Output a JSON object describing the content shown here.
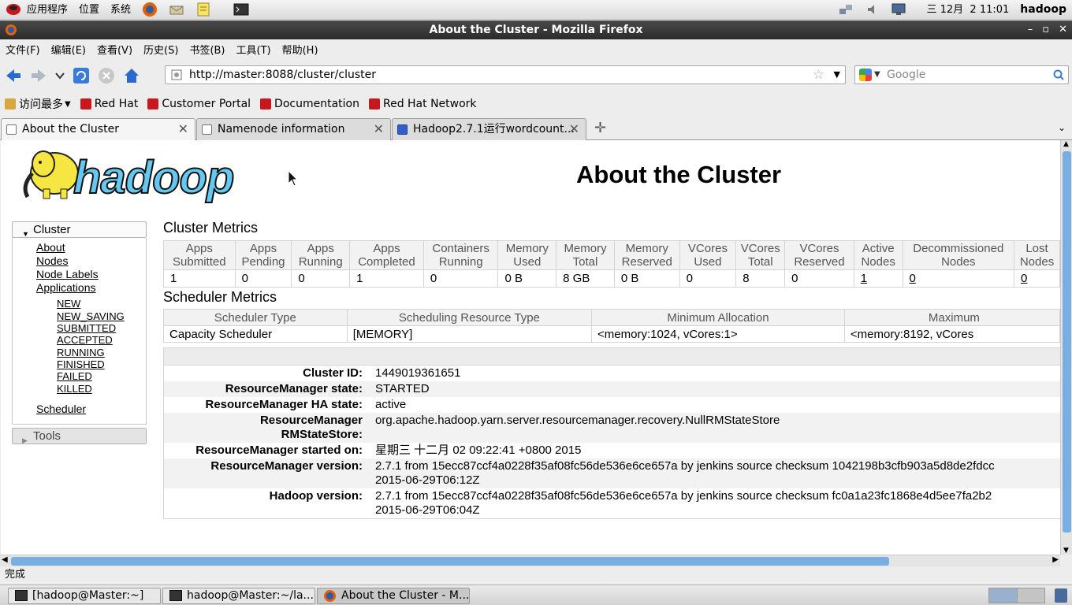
{
  "system_panel": {
    "menus": [
      "应用程序",
      "位置",
      "系统"
    ],
    "clock": "三 12月  2 11:01",
    "user": "hadoop"
  },
  "window": {
    "title": "About the Cluster - Mozilla Firefox"
  },
  "menubar": {
    "items": [
      "文件(F)",
      "编辑(E)",
      "查看(V)",
      "历史(S)",
      "书签(B)",
      "工具(T)",
      "帮助(H)"
    ]
  },
  "navbar": {
    "url": "http://master:8088/cluster/cluster",
    "search_placeholder": "Google"
  },
  "bookmarks": {
    "most_visited": "访问最多",
    "items": [
      "Red Hat",
      "Customer Portal",
      "Documentation",
      "Red Hat Network"
    ]
  },
  "tabs": [
    {
      "label": "About the Cluster"
    },
    {
      "label": "Namenode information"
    },
    {
      "label": "Hadoop2.7.1运行wordcount..."
    }
  ],
  "page": {
    "logo_text": "hadoop",
    "title": "About the Cluster",
    "sidebar": {
      "cluster_label": "Cluster",
      "links": [
        "About",
        "Nodes",
        "Node Labels",
        "Applications"
      ],
      "app_states": [
        "NEW",
        "NEW_SAVING",
        "SUBMITTED",
        "ACCEPTED",
        "RUNNING",
        "FINISHED",
        "FAILED",
        "KILLED"
      ],
      "scheduler": "Scheduler",
      "tools_label": "Tools"
    },
    "cluster_metrics": {
      "title": "Cluster Metrics",
      "headers": [
        [
          "Apps",
          "Submitted"
        ],
        [
          "Apps",
          "Pending"
        ],
        [
          "Apps",
          "Running"
        ],
        [
          "Apps",
          "Completed"
        ],
        [
          "Containers",
          "Running"
        ],
        [
          "Memory",
          "Used"
        ],
        [
          "Memory",
          "Total"
        ],
        [
          "Memory",
          "Reserved"
        ],
        [
          "VCores",
          "Used"
        ],
        [
          "VCores",
          "Total"
        ],
        [
          "VCores",
          "Reserved"
        ],
        [
          "Active",
          "Nodes"
        ],
        [
          "Decommissioned",
          "Nodes"
        ],
        [
          "Lost",
          "Nodes"
        ]
      ],
      "values": [
        "1",
        "0",
        "0",
        "1",
        "0",
        "0 B",
        "8 GB",
        "0 B",
        "0",
        "8",
        "0",
        "1",
        "0",
        "0"
      ]
    },
    "scheduler_metrics": {
      "title": "Scheduler Metrics",
      "headers": [
        "Scheduler Type",
        "Scheduling Resource Type",
        "Minimum Allocation",
        "Maximum"
      ],
      "values": [
        "Capacity Scheduler",
        "[MEMORY]",
        "<memory:1024, vCores:1>",
        "<memory:8192, vCores"
      ]
    },
    "info": [
      {
        "label": "Cluster ID:",
        "value": "1449019361651"
      },
      {
        "label": "ResourceManager state:",
        "value": "STARTED"
      },
      {
        "label": "ResourceManager HA state:",
        "value": "active"
      },
      {
        "label": "ResourceManager\nRMStateStore:",
        "value": "org.apache.hadoop.yarn.server.resourcemanager.recovery.NullRMStateStore"
      },
      {
        "label": "ResourceManager started on:",
        "value": "星期三 十二月 02 09:22:41 +0800 2015"
      },
      {
        "label": "ResourceManager version:",
        "value": "2.7.1 from 15ecc87ccf4a0228f35af08fc56de536e6ce657a by jenkins source checksum 1042198b3cfb903a5d8de2fdcc\n2015-06-29T06:12Z"
      },
      {
        "label": "Hadoop version:",
        "value": "2.7.1 from 15ecc87ccf4a0228f35af08fc56de536e6ce657a by jenkins source checksum fc0a1a23fc1868e4d5ee7fa2b2\n2015-06-29T06:04Z"
      }
    ]
  },
  "statusbar": {
    "text": "完成"
  },
  "taskbar": {
    "tasks": [
      "[hadoop@Master:~]",
      "hadoop@Master:~/la...",
      "About the Cluster - M..."
    ]
  }
}
